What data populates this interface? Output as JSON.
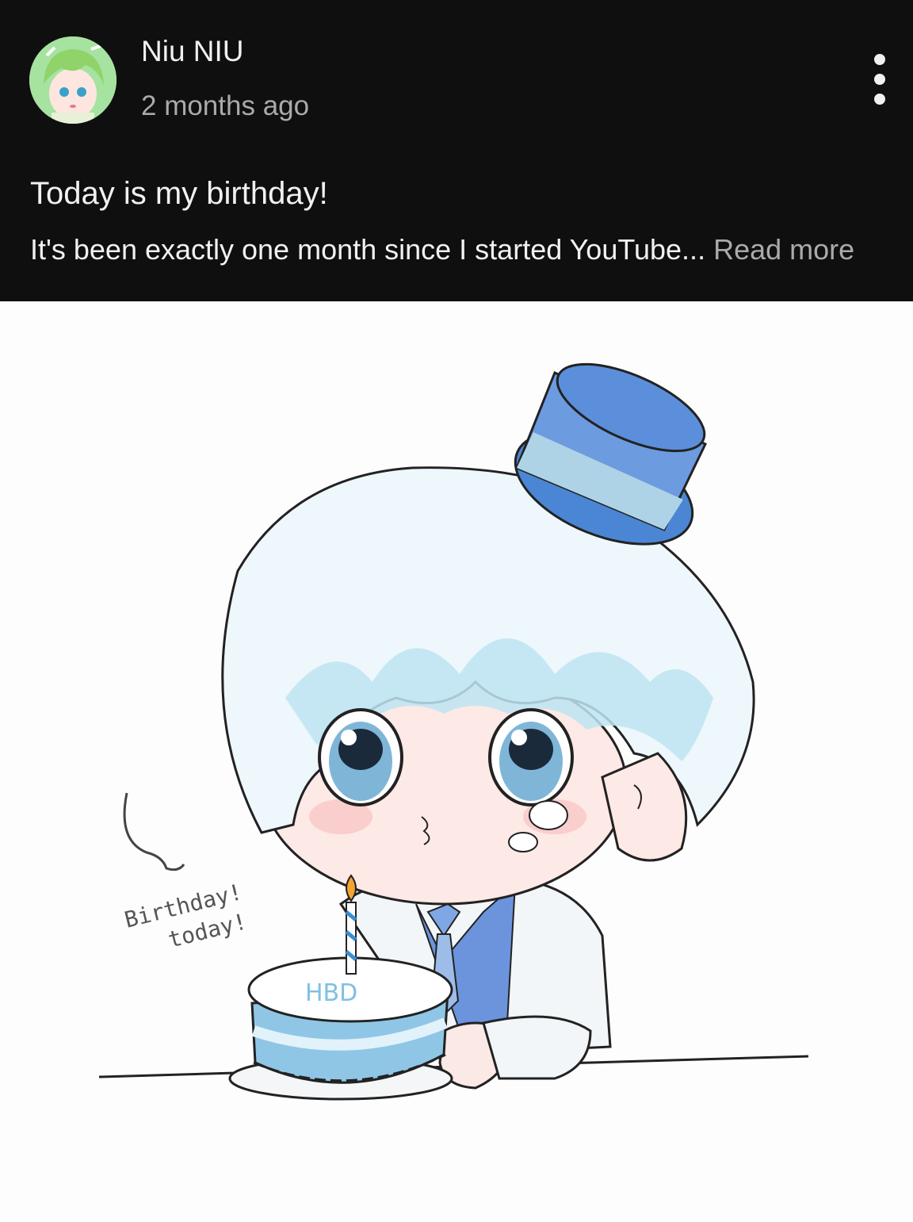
{
  "post": {
    "channel_name": "Niu NIU",
    "time_ago": "2 months ago",
    "title": "Today is my birthday!",
    "excerpt": "It's been exactly one month since I started YouTube...",
    "read_more": "Read more"
  },
  "image": {
    "handwritten_line1": "Birthday!",
    "handwritten_line2": "today!",
    "cake_text": "HBD"
  },
  "icons": {
    "more": "more-vert-icon",
    "avatar": "avatar"
  },
  "colors": {
    "header_bg": "#0f0f0f",
    "header_text": "#f1f1f1",
    "secondary_text": "#aaaaaa",
    "hat_blue": "#4a86d4",
    "hair_blue": "#bde4f2"
  }
}
